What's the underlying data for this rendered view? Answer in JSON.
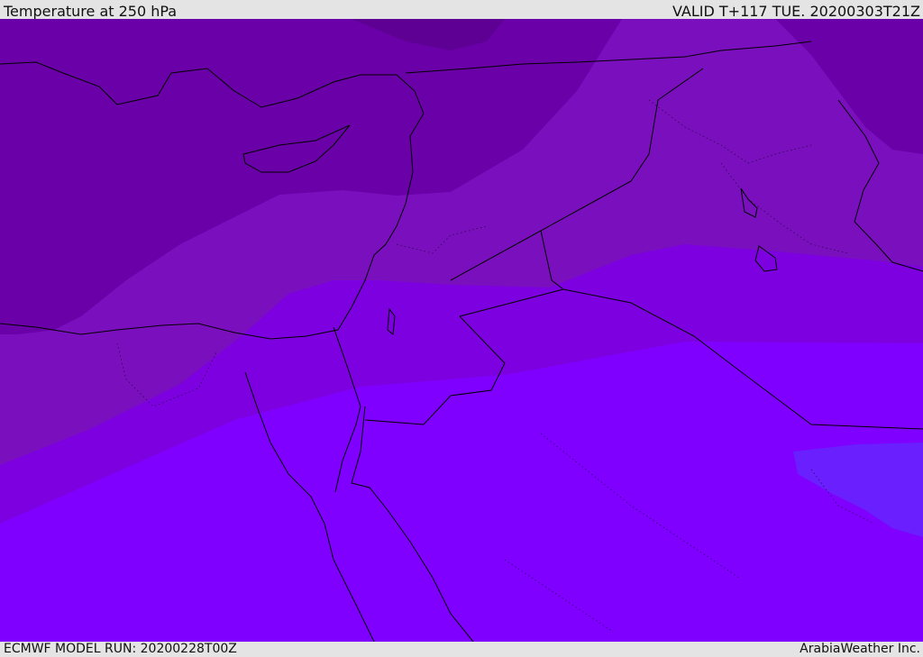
{
  "header": {
    "title": "Temperature at 250 hPa",
    "valid": "VALID T+117 TUE. 20200303T21Z"
  },
  "footer": {
    "model_run": "ECMWF MODEL RUN: 20200228T00Z",
    "credit": "ArabiaWeather Inc."
  },
  "map": {
    "variable": "temperature",
    "level": "250 hPa",
    "colors": {
      "coldest": "#5e0094",
      "cold": "#6a00a8",
      "mid": "#7a0fbe",
      "warm": "#7d00e0",
      "warmer": "#7f00ff",
      "warmest": "#6a1fff",
      "borders": "#000000"
    }
  }
}
